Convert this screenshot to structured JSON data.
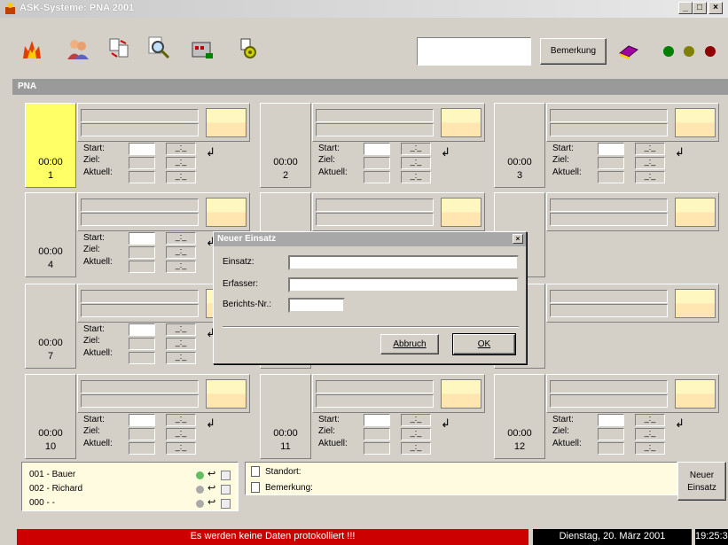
{
  "window": {
    "title": "ASK-Systeme: PNA 2001",
    "buttons": [
      "_",
      "□",
      "×"
    ]
  },
  "toolbar": {
    "bemerkung": "Bemerkung",
    "leds": [
      "#008000",
      "#808000",
      "#800000"
    ]
  },
  "panel": {
    "title": "PNA"
  },
  "labels": {
    "start": "Start:",
    "ziel": "Ziel:",
    "aktuell": "Aktuell:"
  },
  "cells": [
    {
      "time": "00:00",
      "num": "1"
    },
    {
      "time": "00:00",
      "num": "2"
    },
    {
      "time": "00:00",
      "num": "3"
    },
    {
      "time": "00:00",
      "num": "4"
    },
    {
      "time": "",
      "num": ""
    },
    {
      "time": "",
      "num": ""
    },
    {
      "time": "00:00",
      "num": "7"
    },
    {
      "time": "",
      "num": ""
    },
    {
      "time": "",
      "num": ""
    },
    {
      "time": "00:00",
      "num": "10"
    },
    {
      "time": "00:00",
      "num": "11"
    },
    {
      "time": "00:00",
      "num": "12"
    }
  ],
  "dialog": {
    "title": "Neuer Einsatz",
    "einsatz": "Einsatz:",
    "erfasser": "Erfasser:",
    "berichts": "Berichts-Nr.:",
    "abbruch": "Abbruch",
    "ok": "OK"
  },
  "users": [
    "001 - Bauer",
    "002 - Richard",
    "000 - -"
  ],
  "info": {
    "standort": "Standort:",
    "bemerkung": "Bemerkung:"
  },
  "neuer_einsatz": {
    "line1": "Neuer",
    "line2": "Einsatz"
  },
  "status": {
    "message": "Es werden keine Daten protokolliert !!!",
    "date": "Dienstag, 20. März 2001",
    "time": "19:25:36"
  }
}
